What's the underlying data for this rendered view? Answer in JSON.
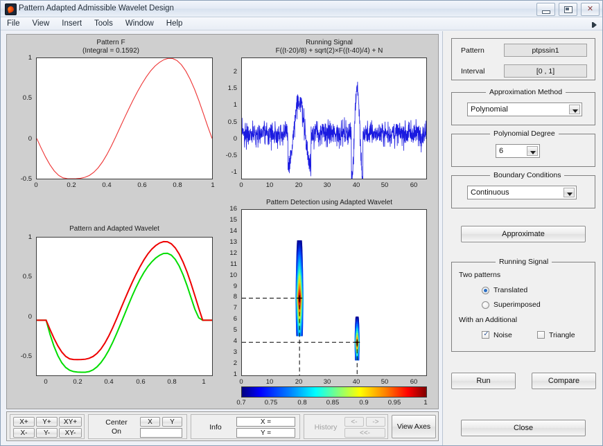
{
  "window": {
    "title": "Pattern Adapted Admissible Wavelet Design",
    "icon": "matlab-icon",
    "minimize": "minimize-icon",
    "maximize": "maximize-icon",
    "close": "close-icon"
  },
  "menu": {
    "items": [
      "File",
      "View",
      "Insert",
      "Tools",
      "Window",
      "Help"
    ],
    "overflow": "menu-overflow-icon"
  },
  "chart_data": [
    {
      "id": "pattern_f",
      "type": "line",
      "title": "Pattern F",
      "subtitle": "(Integral = 0.1592)",
      "xlabel": "",
      "ylabel": "",
      "xlim": [
        0,
        1
      ],
      "ylim": [
        -0.5,
        1
      ],
      "xticks": [
        "0",
        "0.2",
        "0.4",
        "0.6",
        "0.8",
        "1"
      ],
      "yticks": [
        "1",
        "0.5",
        "0",
        "-0.5"
      ],
      "grid": false,
      "series": [
        {
          "name": "Pattern F",
          "color": "#ee3333",
          "x": [
            0,
            0.025,
            0.05,
            0.075,
            0.1,
            0.125,
            0.15,
            0.175,
            0.2,
            0.225,
            0.25,
            0.275,
            0.3,
            0.325,
            0.35,
            0.375,
            0.4,
            0.425,
            0.45,
            0.475,
            0.5,
            0.525,
            0.55,
            0.575,
            0.6,
            0.625,
            0.65,
            0.675,
            0.7,
            0.725,
            0.75,
            0.775,
            0.8,
            0.825,
            0.85,
            0.875,
            0.9,
            0.925,
            0.95,
            0.975,
            1
          ],
          "y": [
            0,
            -0.118,
            -0.229,
            -0.326,
            -0.404,
            -0.459,
            -0.49,
            -0.499,
            -0.5,
            -0.499,
            -0.495,
            -0.483,
            -0.46,
            -0.421,
            -0.365,
            -0.291,
            -0.2,
            -0.096,
            0.018,
            0.137,
            0.255,
            0.37,
            0.481,
            0.585,
            0.681,
            0.768,
            0.843,
            0.903,
            0.948,
            0.981,
            0.998,
            0.996,
            0.97,
            0.918,
            0.84,
            0.737,
            0.613,
            0.469,
            0.312,
            0.151,
            0.0
          ]
        }
      ]
    },
    {
      "id": "running_signal",
      "type": "line",
      "title": "Running Signal",
      "subtitle": "F((t-20)/8) + sqrt(2)×F((t-40)/4) + N",
      "xlabel": "",
      "ylabel": "",
      "xlim": [
        0,
        64
      ],
      "ylim": [
        -1.35,
        2.25
      ],
      "xticks": [
        "0",
        "10",
        "20",
        "30",
        "40",
        "50",
        "60"
      ],
      "yticks": [
        "2",
        "1.5",
        "1",
        "0.5",
        "0",
        "-0.5",
        "-1"
      ],
      "grid": false,
      "series": [
        {
          "name": "Noisy running signal",
          "color": "#1a1ae0",
          "description": "dense blue noise band about 0 with amplitude ~0.6, a broad bump of amplitude ~1.7 around t=20-23, a dip to -1.2 near t=18 and t=39, and a sharp spike to 2.2 at t=41"
        }
      ]
    },
    {
      "id": "pattern_adapted_wavelet",
      "type": "line",
      "title": "Pattern and Adapted Wavelet",
      "subtitle": "",
      "xlabel": "",
      "ylabel": "",
      "xlim": [
        -0.06,
        1.06
      ],
      "ylim": [
        -0.7,
        1.05
      ],
      "xticks": [
        "0",
        "0.2",
        "0.4",
        "0.6",
        "0.8",
        "1"
      ],
      "yticks": [
        "1",
        "0.5",
        "0",
        "-0.5"
      ],
      "grid": false,
      "series": [
        {
          "name": "Pattern",
          "color": "#ee0000",
          "x": [
            -0.06,
            0,
            0.025,
            0.05,
            0.075,
            0.1,
            0.125,
            0.15,
            0.175,
            0.2,
            0.225,
            0.25,
            0.275,
            0.3,
            0.325,
            0.35,
            0.375,
            0.4,
            0.425,
            0.45,
            0.475,
            0.5,
            0.525,
            0.55,
            0.575,
            0.6,
            0.625,
            0.65,
            0.675,
            0.7,
            0.725,
            0.75,
            0.775,
            0.8,
            0.825,
            0.85,
            0.875,
            0.9,
            0.925,
            0.95,
            0.975,
            1,
            1.06
          ],
          "y": [
            0,
            0,
            -0.118,
            -0.229,
            -0.326,
            -0.404,
            -0.459,
            -0.49,
            -0.499,
            -0.5,
            -0.499,
            -0.495,
            -0.483,
            -0.46,
            -0.421,
            -0.365,
            -0.291,
            -0.2,
            -0.096,
            0.018,
            0.137,
            0.255,
            0.37,
            0.481,
            0.585,
            0.681,
            0.768,
            0.843,
            0.903,
            0.948,
            0.981,
            0.998,
            0.996,
            0.97,
            0.918,
            0.84,
            0.737,
            0.613,
            0.469,
            0.312,
            0.151,
            0,
            0
          ]
        },
        {
          "name": "Adapted Wavelet",
          "color": "#00dd00",
          "x": [
            -0.06,
            0,
            0.025,
            0.05,
            0.075,
            0.1,
            0.125,
            0.15,
            0.175,
            0.2,
            0.225,
            0.25,
            0.275,
            0.3,
            0.325,
            0.35,
            0.375,
            0.4,
            0.425,
            0.45,
            0.475,
            0.5,
            0.525,
            0.55,
            0.575,
            0.6,
            0.625,
            0.65,
            0.675,
            0.7,
            0.725,
            0.75,
            0.775,
            0.8,
            0.825,
            0.85,
            0.875,
            0.9,
            0.925,
            0.95,
            0.975,
            1,
            1.06
          ],
          "y": [
            0,
            0,
            -0.18,
            -0.33,
            -0.45,
            -0.54,
            -0.6,
            -0.635,
            -0.652,
            -0.658,
            -0.66,
            -0.66,
            -0.652,
            -0.63,
            -0.592,
            -0.538,
            -0.468,
            -0.382,
            -0.282,
            -0.17,
            -0.052,
            0.07,
            0.192,
            0.31,
            0.42,
            0.52,
            0.608,
            0.682,
            0.742,
            0.79,
            0.825,
            0.848,
            0.85,
            0.826,
            0.772,
            0.688,
            0.575,
            0.44,
            0.29,
            0.14,
            0.03,
            0,
            0
          ]
        }
      ]
    },
    {
      "id": "pattern_detection",
      "type": "heatmap",
      "title": "Pattern Detection using Adapted Wavelet",
      "xlabel": "",
      "ylabel": "",
      "xlim": [
        0,
        64
      ],
      "ylim": [
        1,
        16
      ],
      "xticks": [
        "0",
        "10",
        "20",
        "30",
        "40",
        "50",
        "60"
      ],
      "yticks": [
        "16",
        "15",
        "14",
        "13",
        "12",
        "11",
        "10",
        "9",
        "8",
        "7",
        "6",
        "5",
        "4",
        "3",
        "2",
        "1"
      ],
      "grid": false,
      "crosshairs": [
        {
          "x": 20,
          "y": 8
        },
        {
          "x": 40,
          "y": 4
        }
      ],
      "blobs": [
        {
          "center_x": 20,
          "center_y": 9.5,
          "x_width": 1.4,
          "y_top": 15.7,
          "y_bottom": 4.6,
          "peak_y": 8.0,
          "peak_value": 1.0
        },
        {
          "center_x": 40,
          "center_y": 4.7,
          "x_width": 0.9,
          "y_top": 7.3,
          "y_bottom": 2.4,
          "peak_y": 4.0,
          "peak_value": 0.95
        }
      ],
      "colorbar": {
        "ticks": [
          "0.7",
          "0.75",
          "0.8",
          "0.85",
          "0.9",
          "0.95",
          "1"
        ],
        "min": 0.7,
        "max": 1,
        "colormap": "jet"
      }
    }
  ],
  "toolbar": {
    "zoom_buttons": [
      "X+",
      "Y+",
      "XY+",
      "X-",
      "Y-",
      "XY-"
    ],
    "center_label_line1": "Center",
    "center_label_line2": "On",
    "center_x_button": "X",
    "center_y_button": "Y",
    "center_field_value": "",
    "info_label": "Info",
    "info_x": "X =",
    "info_y": "Y =",
    "history_label": "History",
    "history_back": "<-",
    "history_forward": "->",
    "history_reset": "<<-",
    "view_axes": "View Axes"
  },
  "sidepanel": {
    "pattern_label": "Pattern",
    "pattern_value": "ptpssin1",
    "interval_label": "Interval",
    "interval_value": "[0 , 1]",
    "approx_method_legend": "Approximation Method",
    "approx_method_value": "Polynomial",
    "poly_degree_legend": "Polynomial Degree",
    "poly_degree_value": "6",
    "boundary_legend": "Boundary Conditions",
    "boundary_value": "Continuous",
    "approximate_button": "Approximate",
    "running_signal_legend": "Running Signal",
    "two_patterns_label": "Two patterns",
    "radio_translated": "Translated",
    "radio_superimposed": "Superimposed",
    "radio_selected": "Translated",
    "with_additional_label": "With an Additional",
    "chk_noise": "Noise",
    "chk_noise_checked": true,
    "chk_triangle": "Triangle",
    "chk_triangle_checked": false,
    "run_button": "Run",
    "compare_button": "Compare",
    "close_button": "Close"
  },
  "colors": {
    "pattern_red": "#ee3333",
    "wavelet_green": "#00dd00",
    "signal_blue": "#1a1ae0",
    "canvas_bg": "#cfcfcf",
    "panel_bg": "#f0f0f0"
  }
}
